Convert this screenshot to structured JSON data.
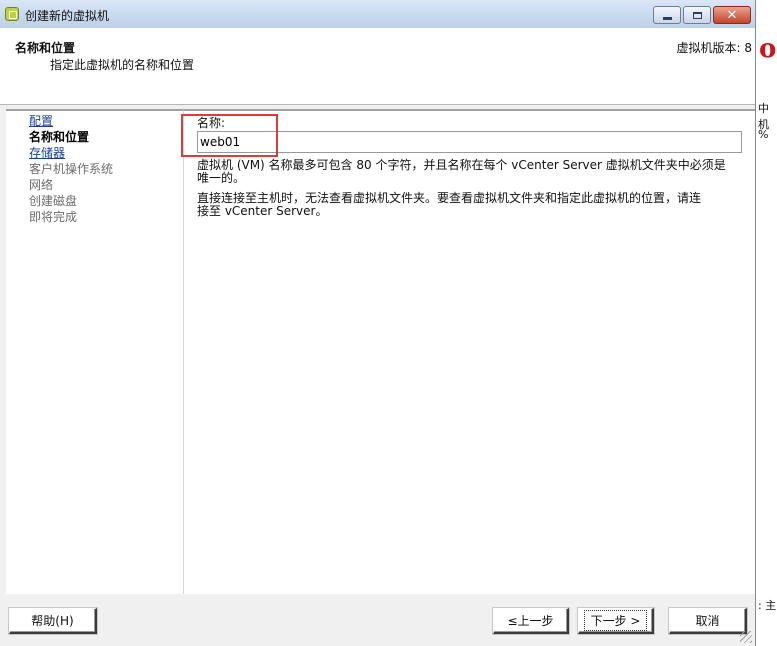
{
  "window": {
    "title": "创建新的虚拟机",
    "close_glyph": "✕"
  },
  "header": {
    "title": "名称和位置",
    "subtitle": "指定此虚拟机的名称和位置",
    "version": "虚拟机版本: 8"
  },
  "steps": [
    {
      "label": "配置",
      "state": "link"
    },
    {
      "label": "名称和位置",
      "state": "current"
    },
    {
      "label": "存储器",
      "state": "link"
    },
    {
      "label": "客户机操作系统",
      "state": "disabled"
    },
    {
      "label": "网络",
      "state": "disabled"
    },
    {
      "label": "创建磁盘",
      "state": "disabled"
    },
    {
      "label": "即将完成",
      "state": "disabled"
    }
  ],
  "form": {
    "name_label": "名称:",
    "name_value": "web01",
    "help1_line1": "虚拟机 (VM) 名称最多可包含 80 个字符，并且名称在每个 vCenter Server 虚拟机文件夹中必须是",
    "help1_line2": "唯一的。",
    "help2_line1": "直接连接至主机时，无法查看虚拟机文件夹。要查看虚拟机文件夹和指定此虚拟机的位置，请连",
    "help2_line2": "接至 vCenter Server。"
  },
  "buttons": {
    "help": "帮助(H)",
    "back": "≤上一步",
    "next": "下一步 >",
    "cancel": "取消"
  },
  "background_window": {
    "red_text": "o",
    "text1": "中机",
    "text2": "%",
    "text3": ": 主"
  },
  "colors": {
    "highlight": "#e0393e",
    "link": "#1c3d9c",
    "close_button": "#c6432a"
  }
}
